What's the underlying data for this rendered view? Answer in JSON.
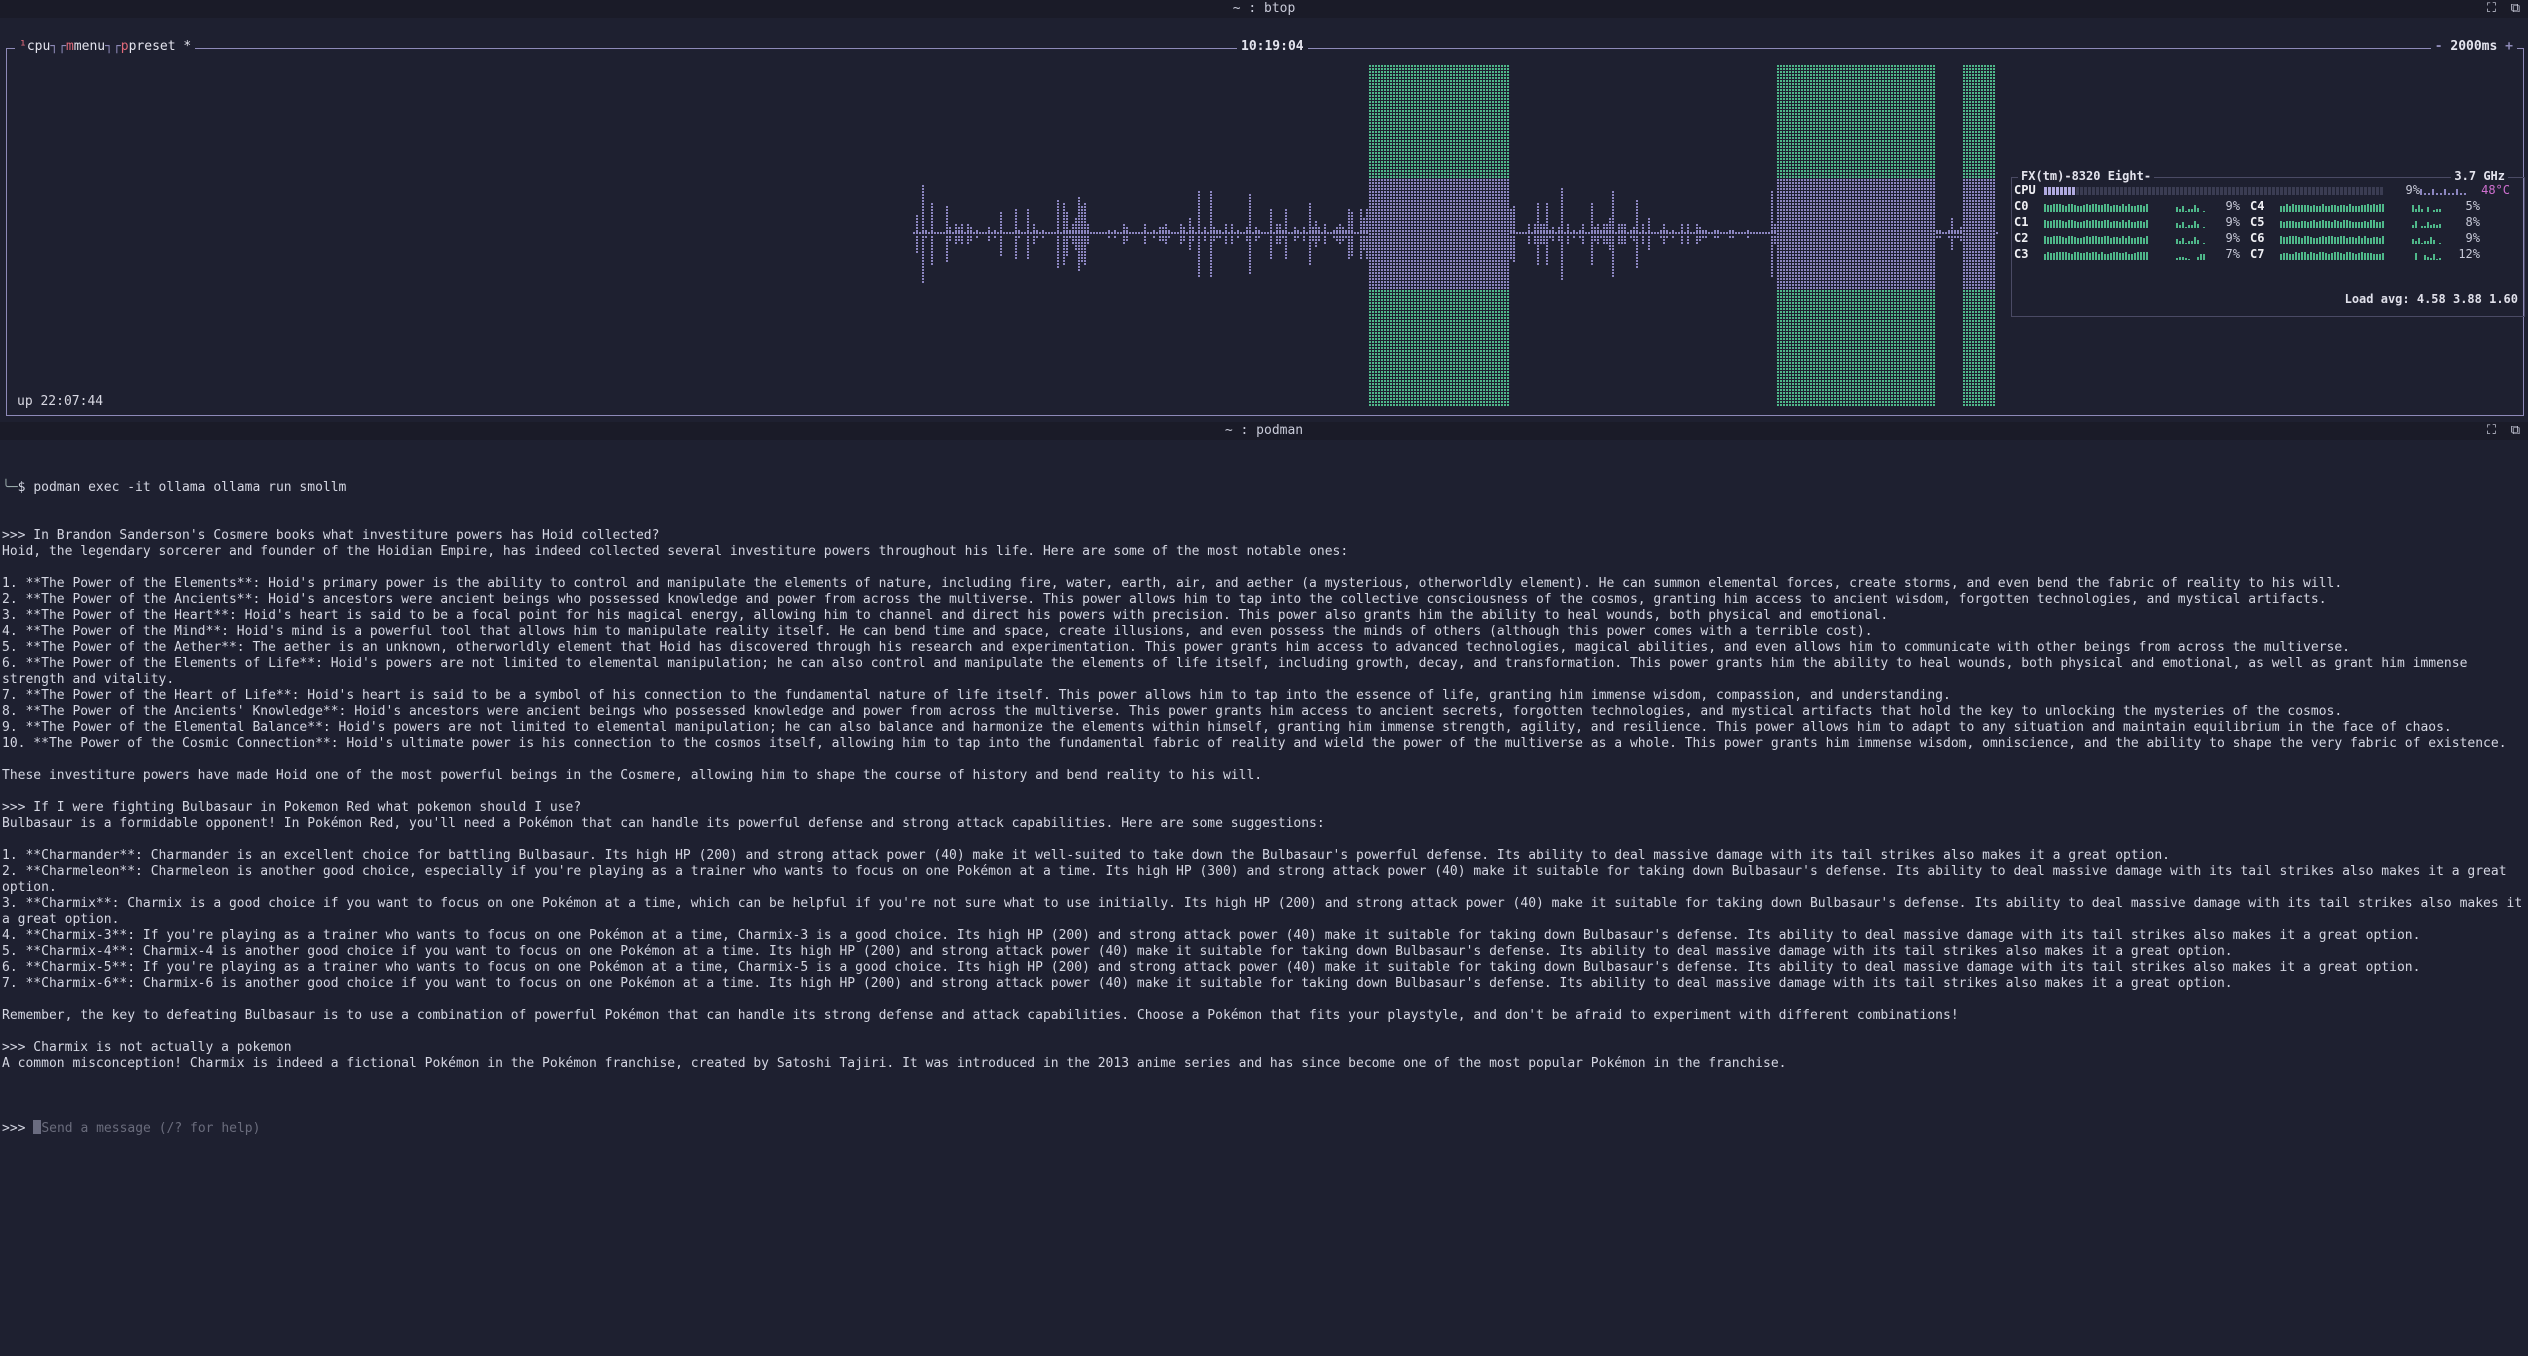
{
  "top_window": {
    "title": "~ : btop"
  },
  "bottom_window": {
    "title": "~ : podman"
  },
  "btop": {
    "tabs": {
      "cpu": "cpu",
      "menu": "menu",
      "preset": "preset *"
    },
    "tab_hotkeys": {
      "cpu": "¹",
      "menu": "m",
      "preset": "p"
    },
    "clock": "10:19:04",
    "refresh": "2000ms",
    "uptime": "up 22:07:44",
    "cpu_model": "FX(tm)-8320 Eight-",
    "frequency": "3.7 GHz",
    "cpu_total": {
      "label": "CPU",
      "percent": "9%",
      "temp": "48°C",
      "load": 0.09
    },
    "cores_left": [
      {
        "label": "C0",
        "percent": "9%",
        "load": 0.09
      },
      {
        "label": "C1",
        "percent": "9%",
        "load": 0.09
      },
      {
        "label": "C2",
        "percent": "9%",
        "load": 0.09
      },
      {
        "label": "C3",
        "percent": "7%",
        "load": 0.07
      }
    ],
    "cores_right": [
      {
        "label": "C4",
        "percent": "5%",
        "load": 0.05
      },
      {
        "label": "C5",
        "percent": "8%",
        "load": 0.08
      },
      {
        "label": "C6",
        "percent": "9%",
        "load": 0.09
      },
      {
        "label": "C7",
        "percent": "12%",
        "load": 0.12
      }
    ],
    "load_avg": "Load avg: 4.58 3.88 1.60",
    "colors": {
      "border": "#8e8ab8",
      "graph_low": "#8c86c0",
      "graph_high": "#4fb88a",
      "accent": "#e06a7a"
    }
  },
  "terminal": {
    "prompt_symbol": "$",
    "command": "podman exec -it ollama ollama run smollm",
    "lines": [
      ">>> In Brandon Sanderson's Cosmere books what investiture powers has Hoid collected?",
      "Hoid, the legendary sorcerer and founder of the Hoidian Empire, has indeed collected several investiture powers throughout his life. Here are some of the most notable ones:",
      "",
      "1. **The Power of the Elements**: Hoid's primary power is the ability to control and manipulate the elements of nature, including fire, water, earth, air, and aether (a mysterious, otherworldly element). He can summon elemental forces, create storms, and even bend the fabric of reality to his will.",
      "2. **The Power of the Ancients**: Hoid's ancestors were ancient beings who possessed knowledge and power from across the multiverse. This power allows him to tap into the collective consciousness of the cosmos, granting him access to ancient wisdom, forgotten technologies, and mystical artifacts.",
      "3. **The Power of the Heart**: Hoid's heart is said to be a focal point for his magical energy, allowing him to channel and direct his powers with precision. This power also grants him the ability to heal wounds, both physical and emotional.",
      "4. **The Power of the Mind**: Hoid's mind is a powerful tool that allows him to manipulate reality itself. He can bend time and space, create illusions, and even possess the minds of others (although this power comes with a terrible cost).",
      "5. **The Power of the Aether**: The aether is an unknown, otherworldly element that Hoid has discovered through his research and experimentation. This power grants him access to advanced technologies, magical abilities, and even allows him to communicate with other beings from across the multiverse.",
      "6. **The Power of the Elements of Life**: Hoid's powers are not limited to elemental manipulation; he can also control and manipulate the elements of life itself, including growth, decay, and transformation. This power grants him the ability to heal wounds, both physical and emotional, as well as grant him immense strength and vitality.",
      "7. **The Power of the Heart of Life**: Hoid's heart is said to be a symbol of his connection to the fundamental nature of life itself. This power allows him to tap into the essence of life, granting him immense wisdom, compassion, and understanding.",
      "8. **The Power of the Ancients' Knowledge**: Hoid's ancestors were ancient beings who possessed knowledge and power from across the multiverse. This power grants him access to ancient secrets, forgotten technologies, and mystical artifacts that hold the key to unlocking the mysteries of the cosmos.",
      "9. **The Power of the Elemental Balance**: Hoid's powers are not limited to elemental manipulation; he can also balance and harmonize the elements within himself, granting him immense strength, agility, and resilience. This power allows him to adapt to any situation and maintain equilibrium in the face of chaos.",
      "10. **The Power of the Cosmic Connection**: Hoid's ultimate power is his connection to the cosmos itself, allowing him to tap into the fundamental fabric of reality and wield the power of the multiverse as a whole. This power grants him immense wisdom, omniscience, and the ability to shape the very fabric of existence.",
      "",
      "These investiture powers have made Hoid one of the most powerful beings in the Cosmere, allowing him to shape the course of history and bend reality to his will.",
      "",
      ">>> If I were fighting Bulbasaur in Pokemon Red what pokemon should I use?",
      "Bulbasaur is a formidable opponent! In Pokémon Red, you'll need a Pokémon that can handle its powerful defense and strong attack capabilities. Here are some suggestions:",
      "",
      "1. **Charmander**: Charmander is an excellent choice for battling Bulbasaur. Its high HP (200) and strong attack power (40) make it well-suited to take down the Bulbasaur's powerful defense. Its ability to deal massive damage with its tail strikes also makes it a great option.",
      "2. **Charmeleon**: Charmeleon is another good choice, especially if you're playing as a trainer who wants to focus on one Pokémon at a time. Its high HP (300) and strong attack power (40) make it suitable for taking down Bulbasaur's defense. Its ability to deal massive damage with its tail strikes also makes it a great option.",
      "3. **Charmix**: Charmix is a good choice if you want to focus on one Pokémon at a time, which can be helpful if you're not sure what to use initially. Its high HP (200) and strong attack power (40) make it suitable for taking down Bulbasaur's defense. Its ability to deal massive damage with its tail strikes also makes it a great option.",
      "4. **Charmix-3**: If you're playing as a trainer who wants to focus on one Pokémon at a time, Charmix-3 is a good choice. Its high HP (200) and strong attack power (40) make it suitable for taking down Bulbasaur's defense. Its ability to deal massive damage with its tail strikes also makes it a great option.",
      "5. **Charmix-4**: Charmix-4 is another good choice if you want to focus on one Pokémon at a time. Its high HP (200) and strong attack power (40) make it suitable for taking down Bulbasaur's defense. Its ability to deal massive damage with its tail strikes also makes it a great option.",
      "6. **Charmix-5**: If you're playing as a trainer who wants to focus on one Pokémon at a time, Charmix-5 is a good choice. Its high HP (200) and strong attack power (40) make it suitable for taking down Bulbasaur's defense. Its ability to deal massive damage with its tail strikes also makes it a great option.",
      "7. **Charmix-6**: Charmix-6 is another good choice if you want to focus on one Pokémon at a time. Its high HP (200) and strong attack power (40) make it suitable for taking down Bulbasaur's defense. Its ability to deal massive damage with its tail strikes also makes it a great option.",
      "",
      "Remember, the key to defeating Bulbasaur is to use a combination of powerful Pokémon that can handle its strong defense and attack capabilities. Choose a Pokémon that fits your playstyle, and don't be afraid to experiment with different combinations!",
      "",
      ">>> Charmix is not actually a pokemon",
      "A common misconception! Charmix is indeed a fictional Pokémon in the Pokémon franchise, created by Satoshi Tajiri. It was introduced in the 2013 anime series and has since become one of the most popular Pokémon in the franchise.",
      ""
    ],
    "input_prompt": ">>> ",
    "input_placeholder": "Send a message (/? for help)"
  }
}
